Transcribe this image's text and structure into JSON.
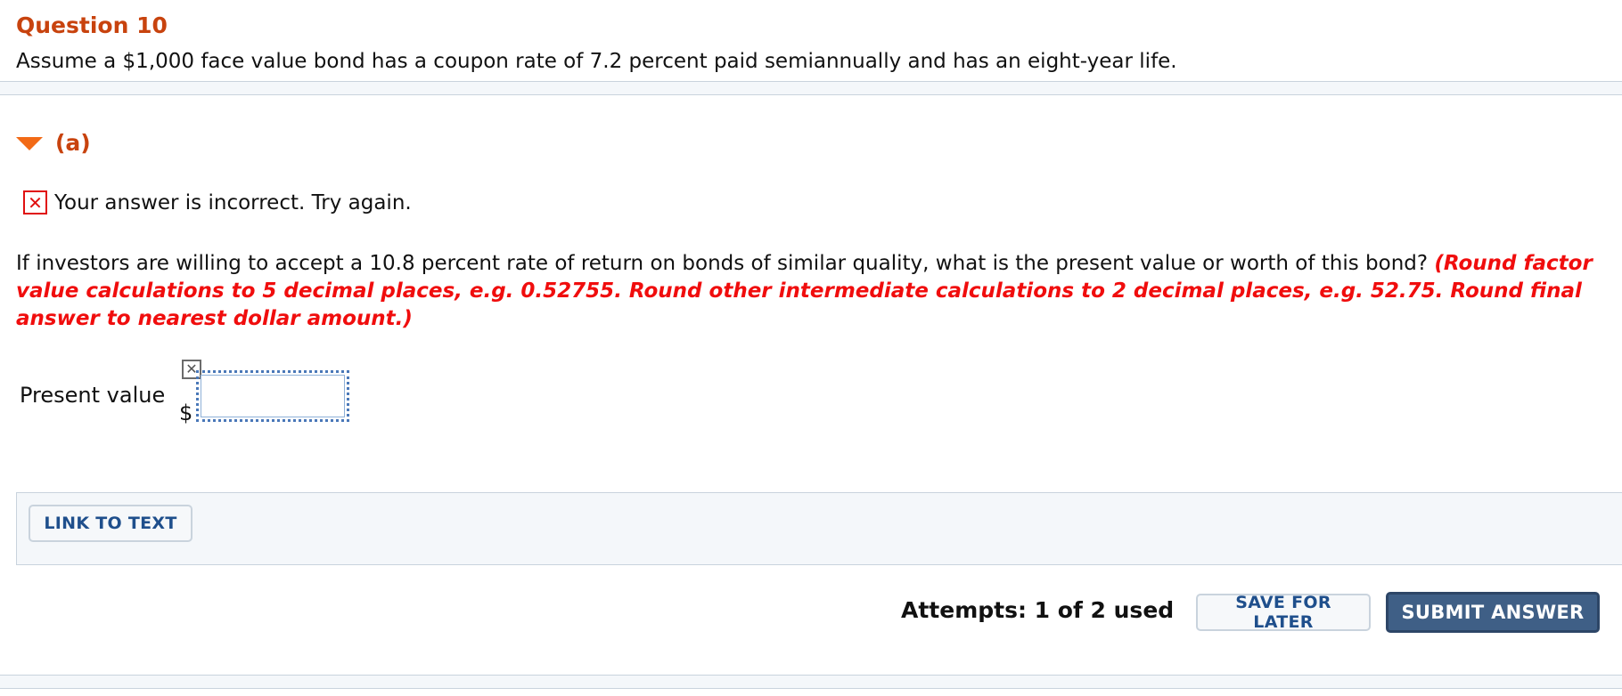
{
  "question": {
    "title": "Question 10",
    "text": "Assume a $1,000 face value bond has a coupon rate of 7.2 percent paid semiannually and has an eight-year life."
  },
  "part": {
    "label": "(a)",
    "feedback": "Your answer is incorrect.  Try again.",
    "question_text": "If investors are willing to accept a 10.8 percent rate of return on bonds of similar quality, what is the present value or worth of this bond? ",
    "instruction": "(Round factor value calculations to 5 decimal places, e.g. 0.52755. Round other intermediate calculations to 2 decimal places, e.g. 52.75. Round final answer to nearest dollar amount.)",
    "field_label": "Present value",
    "currency_symbol": "$",
    "answer_value": ""
  },
  "link_panel": {
    "link_label": "LINK TO TEXT"
  },
  "footer": {
    "attempts": "Attempts: 1 of 2 used",
    "save_label": "SAVE FOR LATER",
    "submit_label": "SUBMIT ANSWER"
  },
  "colors": {
    "title": "#c8430e",
    "instruction": "#f00d0d",
    "triangle": "#f26a16",
    "submit_bg": "#3f5f86",
    "link_text": "#1f4f8c"
  },
  "icons": {
    "incorrect": "x-box-icon",
    "collapse": "triangle-down-icon",
    "marker": "x-marker-icon"
  }
}
